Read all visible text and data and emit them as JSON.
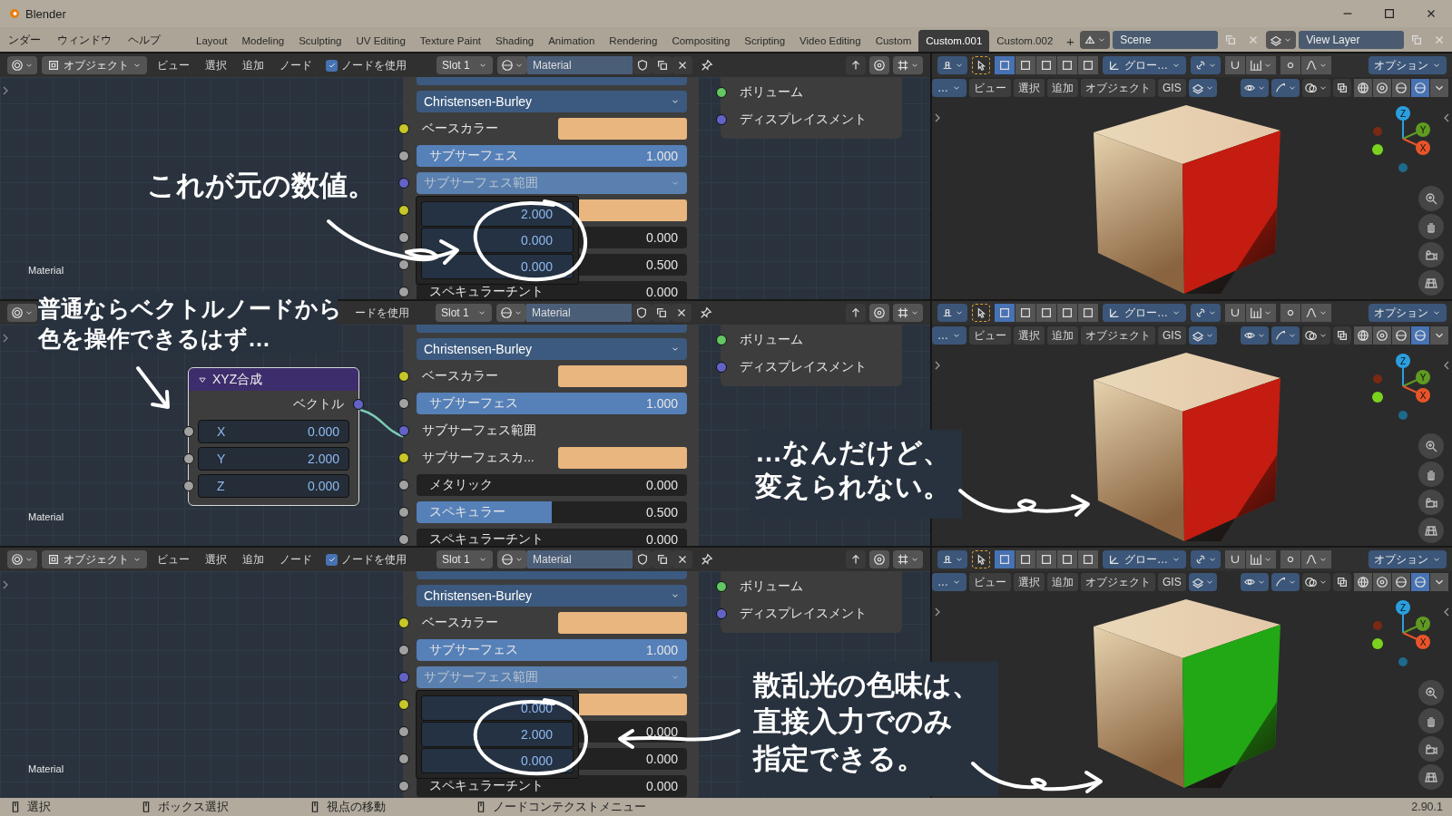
{
  "window": {
    "title": "Blender"
  },
  "menus": [
    "ンダー",
    "ウィンドウ",
    "ヘルプ"
  ],
  "workspaces": [
    {
      "label": "Layout",
      "selected": false
    },
    {
      "label": "Modeling",
      "selected": false
    },
    {
      "label": "Sculpting",
      "selected": false
    },
    {
      "label": "UV Editing",
      "selected": false
    },
    {
      "label": "Texture Paint",
      "selected": false
    },
    {
      "label": "Shading",
      "selected": false
    },
    {
      "label": "Animation",
      "selected": false
    },
    {
      "label": "Rendering",
      "selected": false
    },
    {
      "label": "Compositing",
      "selected": false
    },
    {
      "label": "Scripting",
      "selected": false
    },
    {
      "label": "Video Editing",
      "selected": false
    },
    {
      "label": "Custom",
      "selected": false
    },
    {
      "label": "Custom.001",
      "selected": true
    },
    {
      "label": "Custom.002",
      "selected": false
    }
  ],
  "add_workspace": "+",
  "scene": "Scene",
  "view_layer": "View Layer",
  "panels": [
    {
      "node_header": {
        "items": [
          {
            "kind": "editor"
          },
          {
            "kind": "mode",
            "label": "オブジェクト"
          },
          {
            "kind": "menu",
            "label": "ビュー"
          },
          {
            "kind": "menu",
            "label": "選択"
          },
          {
            "kind": "menu",
            "label": "追加"
          },
          {
            "kind": "menu",
            "label": "ノード"
          },
          {
            "kind": "checkbox",
            "label": "ノードを使用",
            "checked": true
          },
          {
            "kind": "slot",
            "label": "Slot 1"
          },
          {
            "kind": "material",
            "label": "Material"
          }
        ]
      },
      "principled": {
        "rows": [
          {
            "kind": "dropdown",
            "label": "Christensen-Burley",
            "expanded": false
          },
          {
            "kind": "color",
            "label": "ベースカラー",
            "socket": {
              "color": "#c7c729"
            },
            "swatch": {
              "color": "#e8b67e"
            }
          },
          {
            "kind": "slider",
            "label": "サブサーフェス",
            "value": "1.000",
            "level": 1,
            "socket": {
              "color": "#a1a1a1"
            }
          },
          {
            "kind": "dropdown",
            "label": "サブサーフェス範囲",
            "expanded": true,
            "socket": {
              "color": "#6363c7"
            }
          },
          {
            "kind": "color",
            "socket": {
              "color": "#c7c729"
            },
            "swatch": {
              "color": "#e8b67e"
            }
          },
          {
            "kind": "slider",
            "value": "0.000",
            "socket": {
              "color": "#a1a1a1"
            }
          },
          {
            "kind": "slider",
            "value": "0.500",
            "socket": {
              "color": "#a1a1a1"
            }
          },
          {
            "kind": "slider",
            "label": "スペキュラーチント",
            "value": "0.000",
            "socket": {
              "color": "#a1a1a1"
            }
          }
        ],
        "popup": [
          "2.000",
          "0.000",
          "0.000"
        ]
      },
      "output": [
        {
          "label": "ボリューム",
          "color": "#63c763"
        },
        {
          "label": "ディスプレイスメント",
          "color": "#6363c7"
        }
      ],
      "canvas_label": "Material",
      "viewport": {
        "transform": "グロー…",
        "options": "オプション",
        "mode": "…",
        "menus": [
          "ビュー",
          "選択",
          "追加",
          "オブジェクト",
          "GIS"
        ],
        "axes": [
          {
            "label": "Z",
            "color": "#2a9fe0"
          },
          {
            "label": "Y",
            "color": "#5f9a22"
          },
          {
            "label": "X",
            "color": "#e8542a"
          }
        ],
        "cube": {
          "color": "#c41c10"
        }
      }
    },
    {
      "node_header": {
        "items": [
          {
            "kind": "editor"
          },
          {
            "kind": "fragment",
            "label": "ードを使用"
          },
          {
            "kind": "slot",
            "label": "Slot 1"
          },
          {
            "kind": "material",
            "label": "Material"
          }
        ]
      },
      "principled": {
        "rows": [
          {
            "kind": "dropdown",
            "label": "Christensen-Burley",
            "expanded": false
          },
          {
            "kind": "color",
            "label": "ベースカラー",
            "socket": {
              "color": "#c7c729"
            },
            "swatch": {
              "color": "#e8b67e"
            }
          },
          {
            "kind": "slider",
            "label": "サブサーフェス",
            "value": "1.000",
            "level": 1,
            "socket": {
              "color": "#a1a1a1"
            }
          },
          {
            "kind": "socket",
            "label": "サブサーフェス範囲",
            "socket": {
              "color": "#6363c7"
            }
          },
          {
            "kind": "color",
            "label": "サブサーフェスカ...",
            "socket": {
              "color": "#c7c729"
            },
            "swatch": {
              "color": "#e8b67e"
            }
          },
          {
            "kind": "slider",
            "label": "メタリック",
            "value": "0.000",
            "socket": {
              "color": "#a1a1a1"
            }
          },
          {
            "kind": "slider",
            "label": "スペキュラー",
            "value": "0.500",
            "level": 0.5,
            "socket": {
              "color": "#a1a1a1"
            }
          },
          {
            "kind": "slider",
            "label": "スペキュラーチント",
            "value": "0.000",
            "socket": {
              "color": "#a1a1a1"
            }
          }
        ]
      },
      "xyz": {
        "title": "XYZ合成",
        "output": "ベクトル",
        "output_socket": {
          "color": "#6363c7"
        },
        "fields": [
          {
            "label": "X",
            "value": "0.000"
          },
          {
            "label": "Y",
            "value": "2.000"
          },
          {
            "label": "Z",
            "value": "0.000"
          }
        ]
      },
      "output": [
        {
          "label": "ボリューム",
          "color": "#63c763"
        },
        {
          "label": "ディスプレイスメント",
          "color": "#6363c7"
        }
      ],
      "canvas_label": "Material",
      "viewport": {
        "transform": "グロー…",
        "options": "オプション",
        "mode": "…",
        "menus": [
          "ビュー",
          "選択",
          "追加",
          "オブジェクト",
          "GIS"
        ],
        "axes": [
          {
            "label": "Z",
            "color": "#2a9fe0"
          },
          {
            "label": "Y",
            "color": "#5f9a22"
          },
          {
            "label": "X",
            "color": "#e8542a"
          }
        ],
        "cube": {
          "color": "#c41c10"
        }
      }
    },
    {
      "node_header": {
        "items": [
          {
            "kind": "editor"
          },
          {
            "kind": "mode",
            "label": "オブジェクト"
          },
          {
            "kind": "menu",
            "label": "ビュー"
          },
          {
            "kind": "menu",
            "label": "選択"
          },
          {
            "kind": "menu",
            "label": "追加"
          },
          {
            "kind": "menu",
            "label": "ノード"
          },
          {
            "kind": "checkbox",
            "label": "ノードを使用",
            "checked": true
          },
          {
            "kind": "slot",
            "label": "Slot 1"
          },
          {
            "kind": "material",
            "label": "Material"
          }
        ]
      },
      "principled": {
        "rows": [
          {
            "kind": "dropdown",
            "label": "Christensen-Burley",
            "expanded": false
          },
          {
            "kind": "color",
            "label": "ベースカラー",
            "socket": {
              "color": "#c7c729"
            },
            "swatch": {
              "color": "#e8b67e"
            }
          },
          {
            "kind": "slider",
            "label": "サブサーフェス",
            "value": "1.000",
            "level": 1,
            "socket": {
              "color": "#a1a1a1"
            }
          },
          {
            "kind": "dropdown",
            "label": "サブサーフェス範囲",
            "expanded": true,
            "socket": {
              "color": "#6363c7"
            }
          },
          {
            "kind": "color",
            "socket": {
              "color": "#c7c729"
            },
            "swatch": {
              "color": "#e8b67e"
            }
          },
          {
            "kind": "slider",
            "value": "0.000",
            "socket": {
              "color": "#a1a1a1"
            }
          },
          {
            "kind": "slider",
            "value": "0.000",
            "socket": {
              "color": "#a1a1a1"
            }
          },
          {
            "kind": "slider",
            "label": "スペキュラーチント",
            "value": "0.000",
            "socket": {
              "color": "#a1a1a1"
            }
          }
        ],
        "popup": [
          "0.000",
          "2.000",
          "0.000"
        ]
      },
      "output": [
        {
          "label": "ボリューム",
          "color": "#63c763"
        },
        {
          "label": "ディスプレイスメント",
          "color": "#6363c7"
        }
      ],
      "canvas_label": "Material",
      "viewport": {
        "transform": "グロー…",
        "options": "オプション",
        "mode": "…",
        "menus": [
          "ビュー",
          "選択",
          "追加",
          "オブジェクト",
          "GIS"
        ],
        "axes": [
          {
            "label": "Z",
            "color": "#2a9fe0"
          },
          {
            "label": "Y",
            "color": "#5f9a22"
          },
          {
            "label": "X",
            "color": "#e8542a"
          }
        ],
        "cube": {
          "color": "#22a814"
        }
      }
    }
  ],
  "annotations": [
    {
      "lines": [
        "これが元の数値。"
      ]
    },
    {
      "lines": [
        "普通ならベクトルノードから",
        "色を操作できるはず…"
      ]
    },
    {
      "lines": [
        "…なんだけど、",
        "変えられない。"
      ]
    },
    {
      "lines": [
        "散乱光の色味は、",
        "直接入力でのみ",
        "指定できる。"
      ]
    }
  ],
  "status_bar": {
    "items": [
      "選択",
      "ボックス選択",
      "視点の移動",
      "ノードコンテクストメニュー"
    ],
    "version": "2.90.1"
  }
}
